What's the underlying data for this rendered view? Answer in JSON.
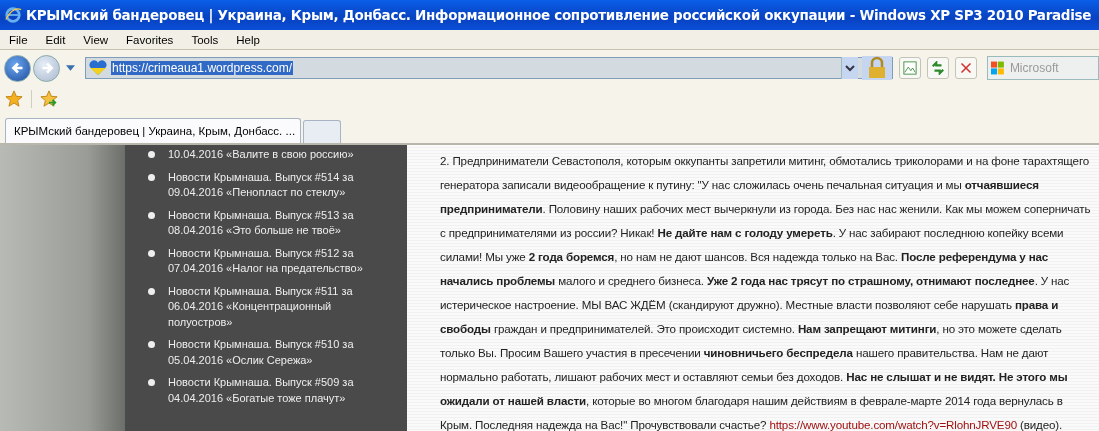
{
  "window": {
    "title": "КРЫМский бандеровец | Украина, Крым, Донбасс. Информационное сопротивление российской оккупации - Windows XP SP3 2010 Paradise"
  },
  "menu": [
    "File",
    "Edit",
    "View",
    "Favorites",
    "Tools",
    "Help"
  ],
  "address_bar": {
    "value": "https://crimeaua1.wordpress.com/"
  },
  "search": {
    "placeholder": "Microsoft"
  },
  "tabs": [
    {
      "label": "КРЫМский бандеровец | Украина, Крым, Донбасс. ...",
      "selected": true
    },
    {
      "selected": false
    }
  ],
  "sidebar": {
    "items": [
      {
        "text": "10.04.2016 «Валите в свою россию»"
      },
      {
        "text": "Новости Крымнаша. Выпуск #514 за 09.04.2016 «Пенопласт по стеклу»"
      },
      {
        "text": "Новости Крымнаша. Выпуск #513 за 08.04.2016 «Это больше не твоё»"
      },
      {
        "text": "Новости Крымнаша. Выпуск #512 за 07.04.2016 «Налог на предательство»"
      },
      {
        "text": "Новости Крымнаша. Выпуск #511 за 06.04.2016 «Концентрационный полуостров»"
      },
      {
        "text": "Новости Крымнаша. Выпуск #510 за 05.04.2016 «Ослик Сережа»"
      },
      {
        "text": "Новости Крымнаша. Выпуск #509 за 04.04.2016 «Богатые тоже плачут»"
      }
    ]
  },
  "article": {
    "text": "2. Предприниматели Севастополя, которым оккупанты запретили митинг, обмотались триколорами и на фоне тарахтящего генератора записали видеообращение к путину: \"У нас сложилась очень печальная ситуация и мы **отчаявшиеся предприниматели**. Половину наших рабочих мест вычеркнули из города. Без нас нас женили. Как мы можем соперничать с предпринимателями из россии? Никак! **Не дайте нам с голоду умереть**. У нас забирают последнюю копейку всеми силами! Мы уже **2 года боремся**, но нам не дают шансов. Вся надежда только на Вас. **После референдума у нас начались проблемы** малого и среднего бизнеса. **Уже 2 года нас трясут по страшному, отнимают последнее**. У нас истерическое настроение. МЫ ВАС ЖДЁМ (скандируют дружно). Местные власти позволяют себе нарушать **права и свободы** граждан и предпринимателей. Это происходит системно. **Нам запрещают митинги**, но это можете сделать только Вы. Просим Вашего участия в пресечении **чиновничьего беспредела** нашего правительства. Нам не дают нормально работать, лишают рабочих мест и оставляют семьи без доходов. **Нас не слышат и не видят. Не этого мы ожидали от нашей власти**, которые во многом благодаря нашим действиям в феврале-марте 2014 года вернулась в Крым. Последняя надежда на Вас!\" Прочувствовали счастье?",
    "link": "https://www.youtube.com/watch?v=RlohnJRVE90",
    "after": "(видео)."
  }
}
